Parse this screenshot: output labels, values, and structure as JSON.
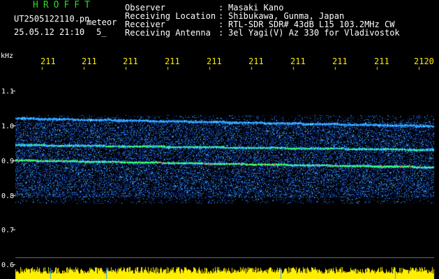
{
  "header": {
    "app_title": "HROFFT",
    "filename": "UT2505122110.pn",
    "mode": "meteor",
    "datetime": "25.05.12 21:10",
    "count": "5_",
    "fields": [
      {
        "label": "Observer",
        "sep": ":",
        "value": "Masaki Kano"
      },
      {
        "label": "Receiving Location",
        "sep": ":",
        "value": "Shibukawa, Gunma, Japan"
      },
      {
        "label": "Receiver",
        "sep": ":",
        "value": "RTL-SDR SDR# 43dB L15 103.2MHz CW"
      },
      {
        "label": "Receiving Antenna",
        "sep": ":",
        "value": "3el Yagi(V) Az 330 for Vladivostok"
      }
    ]
  },
  "axis": {
    "unit": "kHz",
    "y_ticks": [
      "1.1",
      "1.0",
      "0.9",
      "0.8",
      "0.7",
      "0.6"
    ],
    "time_ticks": [
      "211",
      "211",
      "211",
      "211",
      "211",
      "211",
      "211",
      "211",
      "211",
      "2120"
    ]
  },
  "colors": {
    "background": "#000000",
    "header_text": "#ffffff",
    "title_text": "#22dd22",
    "time_tick_text": "#ffee00",
    "signal_low": "#1030a0",
    "signal_mid": "#2aa0ff",
    "signal_high": "#33ff66",
    "signal_peak": "#ff3333",
    "level_bar": "#ffee00"
  }
}
